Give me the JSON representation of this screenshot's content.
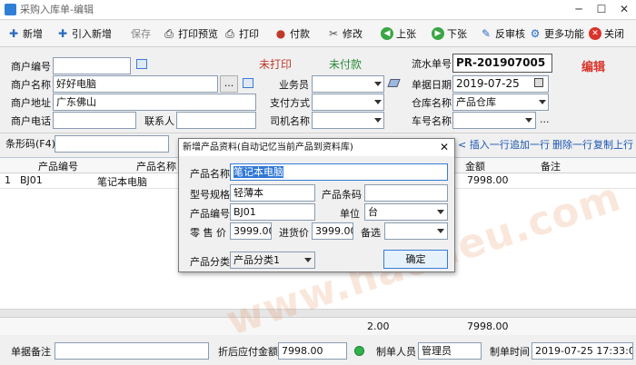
{
  "window": {
    "title": "采购入库单-编辑"
  },
  "toolbar": {
    "new": "新增",
    "import_new": "引入新增",
    "save": "保存",
    "print_preview": "打印预览",
    "print": "打印",
    "pay": "付款",
    "modify": "修改",
    "prev": "上张",
    "next": "下张",
    "unaudit": "反审核",
    "more": "更多功能",
    "close": "关闭"
  },
  "form": {
    "customer_code_label": "商户编号",
    "customer_code": "",
    "customer_name_label": "商户名称",
    "customer_name": "好好电脑",
    "customer_address_label": "商户地址",
    "customer_address": "广东佛山",
    "customer_phone_label": "商户电话",
    "customer_phone": "",
    "contact_label": "联系人",
    "contact": "",
    "print_status": "未打印",
    "pay_status": "未付款",
    "salesman_label": "业务员",
    "salesman": "",
    "payment_label": "支付方式",
    "payment": "",
    "driver_label": "司机名称",
    "driver": "",
    "serial_label": "流水单号",
    "serial": "PR-201907005",
    "date_label": "单据日期",
    "date": "2019-07-25",
    "warehouse_label": "仓库名称",
    "warehouse": "产品仓库",
    "vehicle_label": "车号名称",
    "vehicle": "",
    "mode": "编辑",
    "barcode_label": "条形码(F4)",
    "barcode": ""
  },
  "row_actions": {
    "insert": "插入一行",
    "append": "追加一行",
    "delete": "删除一行",
    "copy": "复制上行"
  },
  "grid": {
    "headers": {
      "code": "产品编号",
      "name": "产品名称",
      "amount": "金额",
      "remark": "备注"
    },
    "rows": [
      {
        "no": "1",
        "code": "BJ01",
        "name": "笔记本电脑",
        "amount": "7998.00",
        "remark": ""
      }
    ],
    "total_qty": "2.00",
    "total_amount": "7998.00"
  },
  "footer": {
    "remark_label": "单据备注",
    "remark": "",
    "payable_label": "折后应付金额",
    "payable": "7998.00",
    "maker_label": "制单人员",
    "maker": "管理员",
    "time_label": "制单时间",
    "time": "2019-07-25 17:33:08"
  },
  "dialog": {
    "title": "新增产品资料(自动记忆当前产品到资料库)",
    "name_label": "产品名称",
    "name": "笔记本电脑",
    "spec_label": "型号规格",
    "spec": "轻薄本",
    "barcode_label": "产品条码",
    "barcode": "",
    "code_label": "产品编号",
    "code": "BJ01",
    "unit_label": "单位",
    "unit": "台",
    "retail_label": "零 售 价",
    "retail": "3999.00",
    "purchase_label": "进货价",
    "purchase": "3999.00",
    "spare_label": "备选",
    "spare": "",
    "category_label": "产品分类",
    "category": "产品分类1",
    "ok": "确定"
  },
  "watermark": "www.haodeu.com"
}
